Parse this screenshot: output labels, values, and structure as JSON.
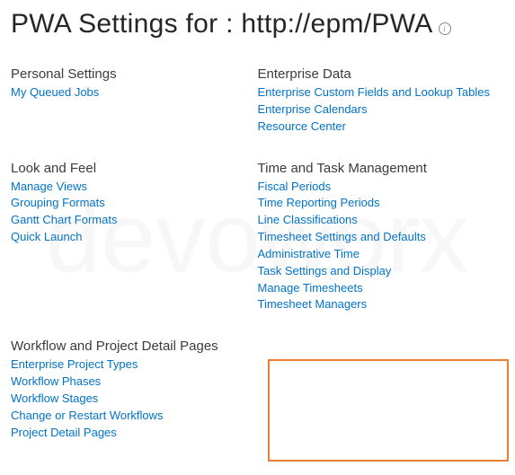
{
  "header": {
    "title": "PWA Settings for : http://epm/PWA"
  },
  "sections": {
    "personal": {
      "title": "Personal Settings",
      "links": [
        "My Queued Jobs"
      ]
    },
    "enterprise": {
      "title": "Enterprise Data",
      "links": [
        "Enterprise Custom Fields and Lookup Tables",
        "Enterprise Calendars",
        "Resource Center"
      ]
    },
    "look": {
      "title": "Look and Feel",
      "links": [
        "Manage Views",
        "Grouping Formats",
        "Gantt Chart Formats",
        "Quick Launch"
      ]
    },
    "time": {
      "title": "Time and Task Management",
      "links": [
        "Fiscal Periods",
        "Time Reporting Periods",
        "Line Classifications",
        "Timesheet Settings and Defaults",
        "Administrative Time",
        "Task Settings and Display",
        "Manage Timesheets",
        "Timesheet Managers"
      ]
    },
    "workflow": {
      "title": "Workflow and Project Detail Pages",
      "links": [
        "Enterprise Project Types",
        "Workflow Phases",
        "Workflow Stages",
        "Change or Restart Workflows",
        "Project Detail Pages"
      ]
    }
  },
  "watermark": "devoworx"
}
